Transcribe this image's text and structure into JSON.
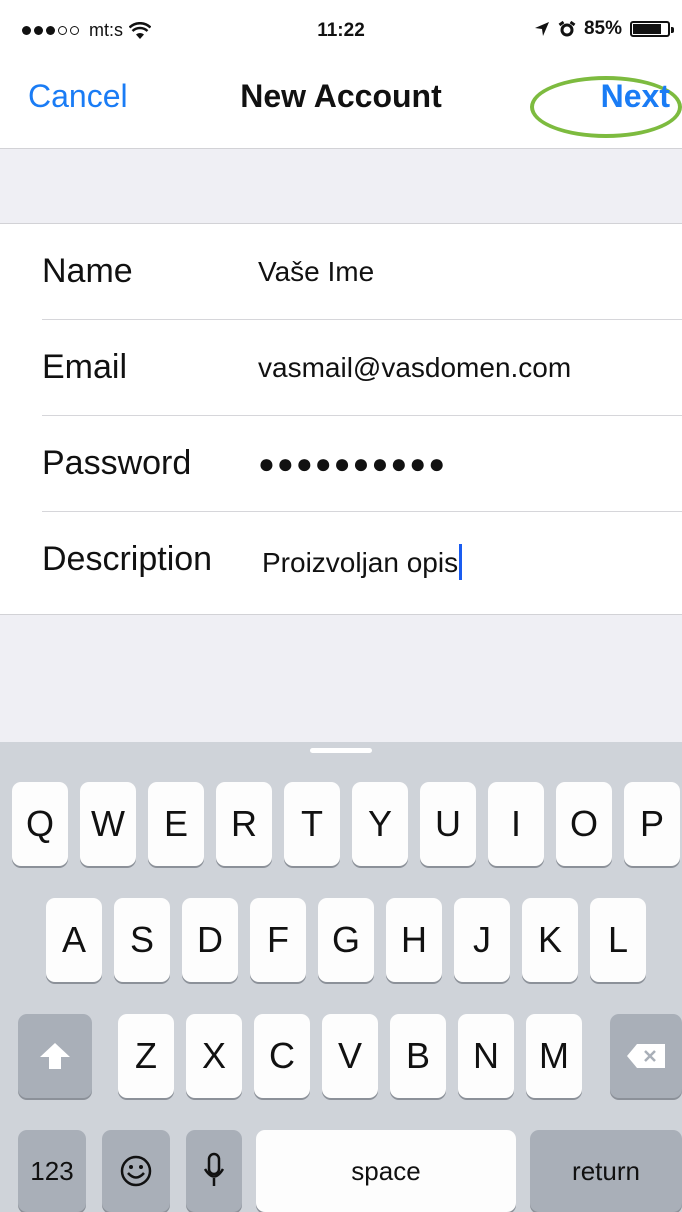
{
  "status_bar": {
    "carrier": "mt:s",
    "time": "11:22",
    "battery": "85%"
  },
  "nav": {
    "cancel": "Cancel",
    "title": "New Account",
    "next": "Next"
  },
  "form": {
    "name_label": "Name",
    "name_value": "Vaše Ime",
    "email_label": "Email",
    "email_value": "vasmail@vasdomen.com",
    "password_label": "Password",
    "password_value": "●●●●●●●●●●",
    "description_label": "Description",
    "description_value": "Proizvoljan opis"
  },
  "keyboard": {
    "row1": [
      "Q",
      "W",
      "E",
      "R",
      "T",
      "Y",
      "U",
      "I",
      "O",
      "P"
    ],
    "row2": [
      "A",
      "S",
      "D",
      "F",
      "G",
      "H",
      "J",
      "K",
      "L"
    ],
    "row3": [
      "Z",
      "X",
      "C",
      "V",
      "B",
      "N",
      "M"
    ],
    "numbers": "123",
    "space": "space",
    "return": "return"
  },
  "colors": {
    "accent": "#1a7cf5",
    "highlight_ring": "#7dbb3f"
  }
}
